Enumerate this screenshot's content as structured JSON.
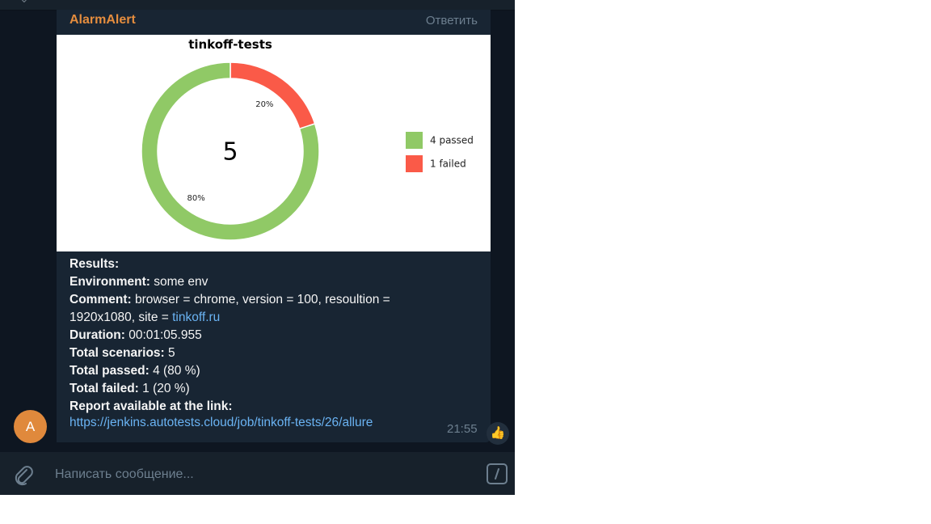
{
  "message": {
    "sender": "AlarmAlert",
    "reply_label": "Ответить",
    "time": "21:55",
    "avatar_letter": "A",
    "reaction": "👍"
  },
  "results": {
    "heading": "Results:",
    "environment_label": "Environment:",
    "environment_value": "some env",
    "comment_label": "Comment:",
    "comment_value": "browser = chrome, version = 100, resoultion = 1920x1080, site =",
    "comment_link": "tinkoff.ru",
    "duration_label": "Duration:",
    "duration_value": "00:01:05.955",
    "total_scenarios_label": "Total scenarios:",
    "total_scenarios_value": "5",
    "total_passed_label": "Total passed:",
    "total_passed_value": "4 (80 %)",
    "total_failed_label": "Total failed:",
    "total_failed_value": "1 (20 %)",
    "report_label": "Report available at the link:",
    "report_url": "https://jenkins.autotests.cloud/job/tinkoff-tests/26/allure"
  },
  "composer": {
    "placeholder": "Написать сообщение..."
  },
  "chart_data": {
    "type": "pie",
    "title": "tinkoff-tests",
    "center_label": "5",
    "slices": [
      {
        "name": "4 passed",
        "value": 4,
        "pct_label": "80%",
        "color": "#90c966"
      },
      {
        "name": "1 failed",
        "value": 1,
        "pct_label": "20%",
        "color": "#fa5a48"
      }
    ],
    "legend_placement": "right"
  },
  "colors": {
    "bg": "#0e1621",
    "bubble": "#182533",
    "accent_name": "#e58d3e",
    "link": "#6ab3f3"
  },
  "icons": [
    "attach-icon",
    "command-icon",
    "thumbs-up-icon"
  ]
}
